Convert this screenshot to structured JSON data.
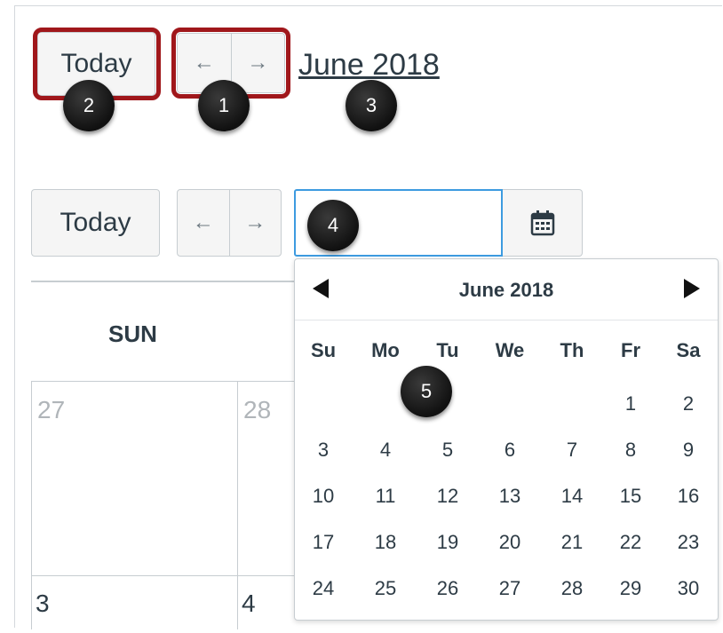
{
  "header": {
    "today_label": "Today",
    "prev_arrow": "←",
    "next_arrow": "→",
    "month_title": "June 2018"
  },
  "toolbar": {
    "today_label": "Today",
    "prev_arrow": "←",
    "next_arrow": "→",
    "date_input_value": "",
    "calendar_icon": "calendar-icon"
  },
  "callouts": [
    "1",
    "2",
    "3",
    "4",
    "5"
  ],
  "calendar": {
    "first_column_header": "SUN",
    "visible_days": [
      "27",
      "28",
      "3",
      "4"
    ]
  },
  "picker": {
    "title": "June 2018",
    "weekdays": [
      "Su",
      "Mo",
      "Tu",
      "We",
      "Th",
      "Fr",
      "Sa"
    ],
    "weeks": [
      [
        "",
        "",
        "",
        "",
        "",
        "1",
        "2"
      ],
      [
        "3",
        "4",
        "5",
        "6",
        "7",
        "8",
        "9"
      ],
      [
        "10",
        "11",
        "12",
        "13",
        "14",
        "15",
        "16"
      ],
      [
        "17",
        "18",
        "19",
        "20",
        "21",
        "22",
        "23"
      ],
      [
        "24",
        "25",
        "26",
        "27",
        "28",
        "29",
        "30"
      ]
    ]
  },
  "colors": {
    "highlight": "#a0171b",
    "focus": "#3d9be0",
    "muted_day": "#b0b5b9"
  }
}
